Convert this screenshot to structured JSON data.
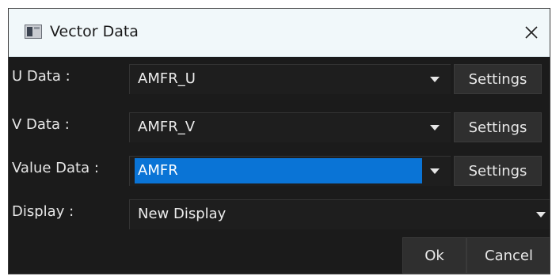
{
  "window": {
    "title": "Vector Data"
  },
  "rows": [
    {
      "label": "U Data :",
      "value": "AMFR_U",
      "settings_label": "Settings"
    },
    {
      "label": "V Data :",
      "value": "AMFR_V",
      "settings_label": "Settings"
    },
    {
      "label": "Value Data :",
      "value": "AMFR",
      "settings_label": "Settings"
    },
    {
      "label": "Display :",
      "value": "New Display"
    }
  ],
  "footer": {
    "ok_label": "Ok",
    "cancel_label": "Cancel"
  },
  "icons": {
    "app": "window-app-icon",
    "close": "close-icon",
    "dropdown": "dropdown-arrow-icon"
  },
  "colors": {
    "background": "#1b1b1b",
    "titlebar": "#f1f8fa",
    "selection": "#0a74d6",
    "button": "#2f2f2f"
  }
}
